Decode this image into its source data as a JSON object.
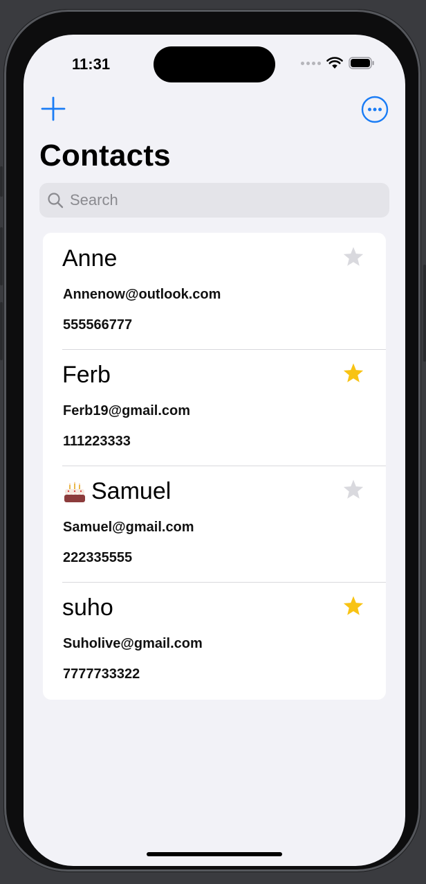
{
  "status_bar": {
    "time": "11:31"
  },
  "nav": {
    "add_icon": "plus-icon",
    "more_icon": "ellipsis-circle-icon"
  },
  "title": "Contacts",
  "search": {
    "placeholder": "Search",
    "value": ""
  },
  "contacts": [
    {
      "name": "Anne",
      "email": "Annenow@outlook.com",
      "phone": "555566777",
      "favorite": false,
      "birthday_icon": false
    },
    {
      "name": "Ferb",
      "email": "Ferb19@gmail.com",
      "phone": "111223333",
      "favorite": true,
      "birthday_icon": false
    },
    {
      "name": "Samuel",
      "email": "Samuel@gmail.com",
      "phone": "222335555",
      "favorite": false,
      "birthday_icon": true
    },
    {
      "name": "suho",
      "email": "Suholive@gmail.com",
      "phone": "7777733322",
      "favorite": true,
      "birthday_icon": false
    }
  ],
  "colors": {
    "accent": "#1a7cf5",
    "star_on": "#f8c314",
    "star_off": "#d9d9de",
    "background": "#f2f2f7"
  }
}
